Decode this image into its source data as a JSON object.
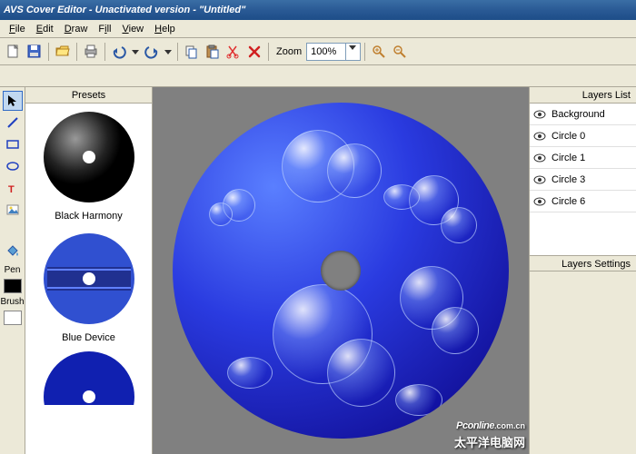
{
  "title": "AVS Cover Editor - Unactivated version - \"Untitled\"",
  "menu": {
    "file": "File",
    "edit": "Edit",
    "draw": "Draw",
    "fill": "Fill",
    "view": "View",
    "help": "Help"
  },
  "zoom": {
    "label": "Zoom",
    "value": "100%"
  },
  "presets": {
    "header": "Presets",
    "items": [
      {
        "name": "Black Harmony"
      },
      {
        "name": "Blue Device"
      }
    ]
  },
  "layers": {
    "header": "Layers List",
    "settings": "Layers Settings",
    "items": [
      {
        "name": "Background"
      },
      {
        "name": "Circle 0"
      },
      {
        "name": "Circle 1"
      },
      {
        "name": "Circle 3"
      },
      {
        "name": "Circle 6"
      }
    ]
  },
  "toolbox": {
    "pen": "Pen",
    "brush": "Brush"
  },
  "watermark": {
    "line1": "Pconline",
    "suffix": ".com.cn",
    "line2": "太平洋电脑网"
  }
}
